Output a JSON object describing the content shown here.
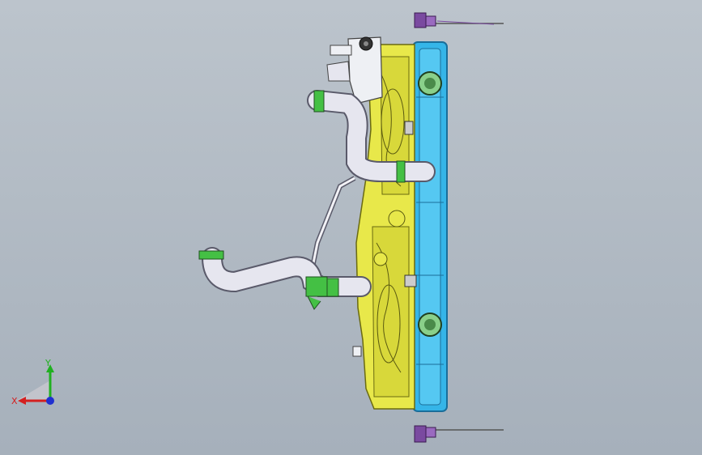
{
  "viewport": {
    "background_top": "#bcc4cc",
    "background_bottom": "#a6b0bb"
  },
  "colors": {
    "radiator_tank": "#35b5e8",
    "radiator_edge": "#1a6e9a",
    "fan_shroud": "#e8e84a",
    "shroud_edge": "#6a6a10",
    "hose": "#e6e6ef",
    "hose_edge": "#5a5a6a",
    "clamp": "#44c044",
    "bracket": "#7a4aa0",
    "axis_x": "#d42020",
    "axis_y": "#20b020",
    "axis_z": "#2030d0"
  },
  "triad": {
    "x_label": "X",
    "y_label": "Y"
  },
  "icons": {
    "triad": "coordinate-triad-icon",
    "top_bracket": "mounting-bracket-icon",
    "bottom_bracket": "mounting-bracket-icon"
  }
}
